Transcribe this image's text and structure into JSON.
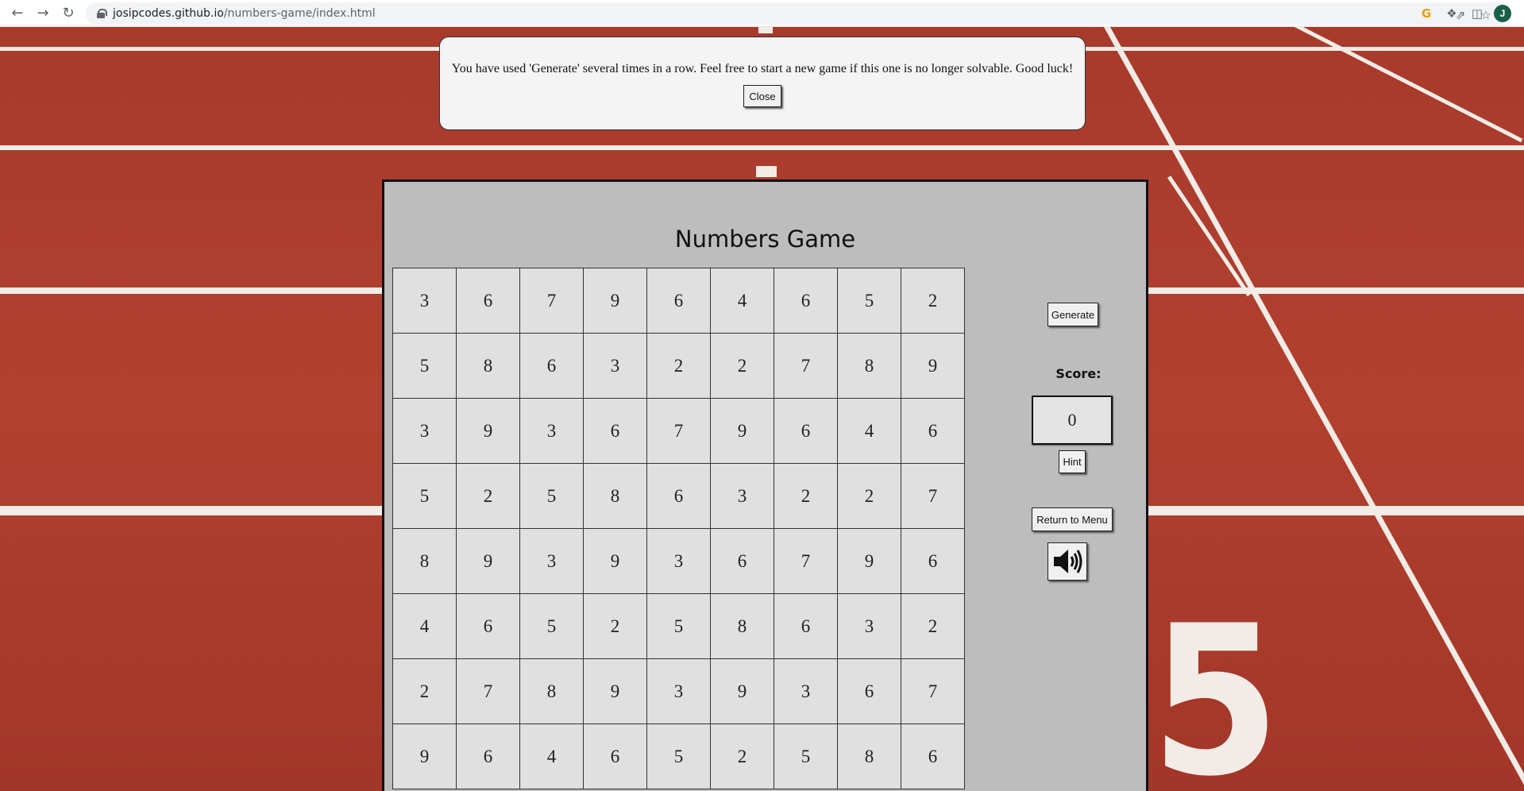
{
  "browser": {
    "url_host": "josipcodes.github.io",
    "url_path": "/numbers-game/index.html",
    "avatar_letter": "J"
  },
  "alert": {
    "message": "You have used 'Generate' several times in a row. Feel free to start a new game if this one is no longer solvable. Good luck!",
    "close_label": "Close"
  },
  "game": {
    "title": "Numbers Game",
    "grid": [
      [
        "3",
        "6",
        "7",
        "9",
        "6",
        "4",
        "6",
        "5",
        "2"
      ],
      [
        "5",
        "8",
        "6",
        "3",
        "2",
        "2",
        "7",
        "8",
        "9"
      ],
      [
        "3",
        "9",
        "3",
        "6",
        "7",
        "9",
        "6",
        "4",
        "6"
      ],
      [
        "5",
        "2",
        "5",
        "8",
        "6",
        "3",
        "2",
        "2",
        "7"
      ],
      [
        "8",
        "9",
        "3",
        "9",
        "3",
        "6",
        "7",
        "9",
        "6"
      ],
      [
        "4",
        "6",
        "5",
        "2",
        "5",
        "8",
        "6",
        "3",
        "2"
      ],
      [
        "2",
        "7",
        "8",
        "9",
        "3",
        "9",
        "3",
        "6",
        "7"
      ],
      [
        "9",
        "6",
        "4",
        "6",
        "5",
        "2",
        "5",
        "8",
        "6"
      ]
    ],
    "generate_label": "Generate",
    "score_label": "Score:",
    "score_value": "0",
    "hint_label": "Hint",
    "menu_label": "Return to Menu",
    "sound_icon": "speaker-volume-icon"
  }
}
